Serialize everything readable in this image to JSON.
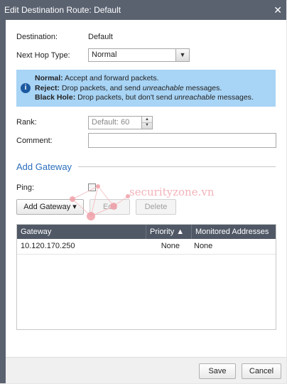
{
  "dialog": {
    "title": "Edit Destination Route: Default",
    "close_glyph": "✕"
  },
  "form": {
    "destination_label": "Destination:",
    "destination_value": "Default",
    "next_hop_label": "Next Hop Type:",
    "next_hop_value": "Normal",
    "rank_label": "Rank:",
    "rank_placeholder": "Default: 60",
    "comment_label": "Comment:",
    "comment_value": ""
  },
  "info": {
    "line1_bold": "Normal:",
    "line1_text": " Accept and forward packets.",
    "line2_bold": "Reject:",
    "line2_text_a": " Drop packets, and send ",
    "line2_em": "unreachable",
    "line2_text_b": " messages.",
    "line3_bold": "Black Hole:",
    "line3_text_a": " Drop packets, but don't send ",
    "line3_em": "unreachable",
    "line3_text_b": " messages."
  },
  "gateway_section": {
    "title": "Add Gateway",
    "ping_label": "Ping:",
    "add_button": "Add Gateway ▾",
    "edit_button": "Edit",
    "delete_button": "Delete"
  },
  "grid": {
    "columns": [
      "Gateway",
      "Priority ▲",
      "Monitored Addresses"
    ],
    "rows": [
      {
        "gateway": "10.120.170.250",
        "priority": "None",
        "monitored": "None"
      }
    ]
  },
  "watermark": {
    "text": "securityzone.vn"
  },
  "footer": {
    "save_button": "Save",
    "cancel_button": "Cancel"
  }
}
